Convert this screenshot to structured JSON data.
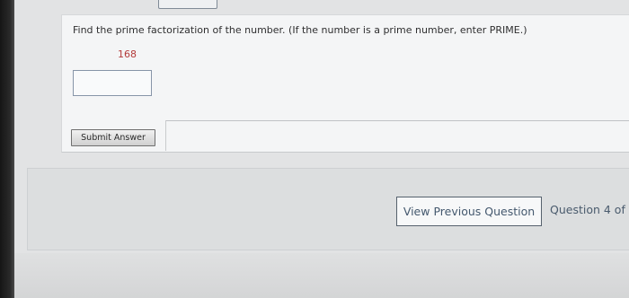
{
  "question": {
    "prompt": "Find the prime factorization of the number. (If the number is a prime number, enter PRIME.)",
    "number": "168",
    "answer_value": ""
  },
  "submit_label": "Submit Answer",
  "navigation": {
    "view_previous_label": "View Previous Question",
    "question_counter": "Question 4 of"
  }
}
